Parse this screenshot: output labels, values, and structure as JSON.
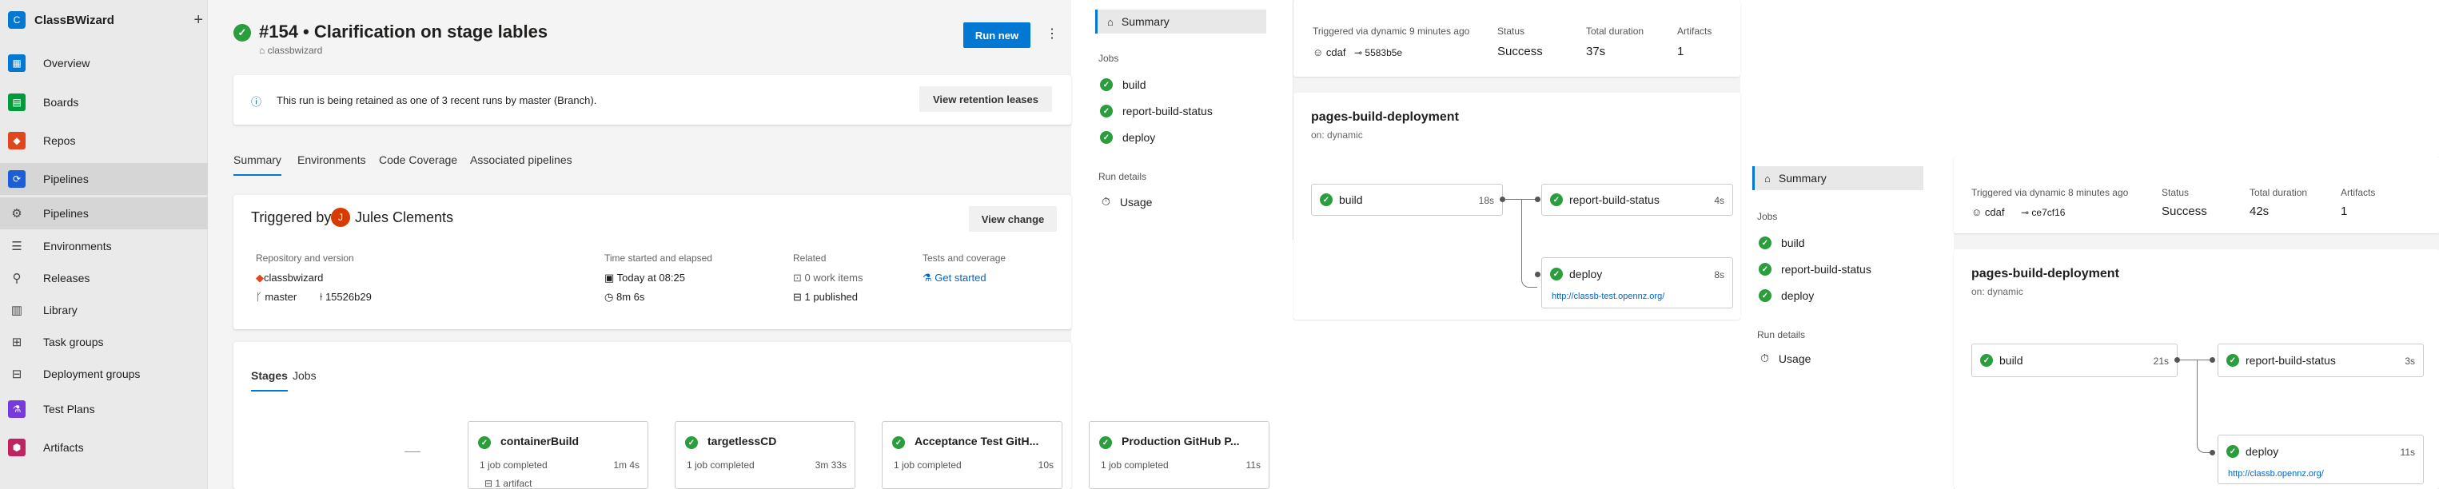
{
  "org": {
    "badge": "C",
    "name": "ClassBWizard",
    "add": "+"
  },
  "nav": {
    "items": [
      {
        "label": "Overview",
        "icon": "overview-icon",
        "color": "#0078d4",
        "glyph": "▦"
      },
      {
        "label": "Boards",
        "icon": "boards-icon",
        "color": "#009c3b",
        "glyph": "▤"
      },
      {
        "label": "Repos",
        "icon": "repos-icon",
        "color": "#e0471c",
        "glyph": "◆"
      },
      {
        "label": "Pipelines",
        "icon": "pipelines-icon",
        "color": "#1c5ed8",
        "glyph": "⟳"
      },
      {
        "label": "Pipelines",
        "icon": "pipelines-sub-icon",
        "color": "#444",
        "glyph": "⚙"
      },
      {
        "label": "Environments",
        "icon": "environments-icon",
        "color": "#444",
        "glyph": "☰"
      },
      {
        "label": "Releases",
        "icon": "releases-icon",
        "color": "#444",
        "glyph": "⚲"
      },
      {
        "label": "Library",
        "icon": "library-icon",
        "color": "#444",
        "glyph": "▥"
      },
      {
        "label": "Task groups",
        "icon": "task-groups-icon",
        "color": "#444",
        "glyph": "⊞"
      },
      {
        "label": "Deployment groups",
        "icon": "deployment-groups-icon",
        "color": "#444",
        "glyph": "⊟"
      },
      {
        "label": "Test Plans",
        "icon": "test-plans-icon",
        "color": "#773adc",
        "glyph": "⚗"
      },
      {
        "label": "Artifacts",
        "icon": "artifacts-icon",
        "color": "#c0245e",
        "glyph": "⬢"
      }
    ]
  },
  "run": {
    "title": "#154 • Clarification on stage lables",
    "repo": "classbwizard",
    "run_new": "Run new",
    "more": "⋮",
    "banner": "This run is being retained as one of 3 recent runs by master (Branch).",
    "view_retention": "View retention leases",
    "tabs": [
      "Summary",
      "Environments",
      "Code Coverage",
      "Associated pipelines"
    ],
    "triggered_by_label": "Triggered by",
    "triggered_by": "Jules Clements",
    "view_change": "View change",
    "repo_version_label": "Repository and version",
    "repo_name": "classbwizard",
    "branch": "master",
    "commit": "15526b29",
    "time_label": "Time started and elapsed",
    "time_started": "Today at 08:25",
    "elapsed": "8m 6s",
    "related_label": "Related",
    "work_items": "0 work items",
    "published": "1 published",
    "tests_label": "Tests and coverage",
    "get_started": "Get started",
    "stage_tabs": [
      "Stages",
      "Jobs"
    ],
    "stages": [
      {
        "name": "containerBuild",
        "jobs": "1 job completed",
        "duration": "1m 4s",
        "extra": "1 artifact"
      },
      {
        "name": "targetlessCD",
        "jobs": "1 job completed",
        "duration": "3m 33s",
        "extra": ""
      },
      {
        "name": "Acceptance Test GitH...",
        "jobs": "1 job completed",
        "duration": "10s",
        "extra": ""
      },
      {
        "name": "Production GitHub P...",
        "jobs": "1 job completed",
        "duration": "11s",
        "extra": ""
      }
    ]
  },
  "panel1": {
    "summary": "Summary",
    "jobs_label": "Jobs",
    "jobs": [
      "build",
      "report-build-status",
      "deploy"
    ],
    "run_details": "Run details",
    "usage": "Usage",
    "triggered": "Triggered via dynamic 9 minutes ago",
    "user": "cdaf",
    "commit": "5583b5e",
    "status_label": "Status",
    "status": "Success",
    "duration_label": "Total duration",
    "duration": "37s",
    "artifacts_label": "Artifacts",
    "artifacts": "1",
    "workflow": "pages-build-deployment",
    "on": "on: dynamic",
    "build_dur": "18s",
    "report_dur": "4s",
    "deploy_dur": "8s",
    "deploy_url": "http://classb-test.opennz.org/"
  },
  "panel2": {
    "summary": "Summary",
    "jobs_label": "Jobs",
    "jobs": [
      "build",
      "report-build-status",
      "deploy"
    ],
    "run_details": "Run details",
    "usage": "Usage",
    "triggered": "Triggered via dynamic 8 minutes ago",
    "user": "cdaf",
    "commit": "ce7cf16",
    "status_label": "Status",
    "status": "Success",
    "duration_label": "Total duration",
    "duration": "42s",
    "artifacts_label": "Artifacts",
    "artifacts": "1",
    "workflow": "pages-build-deployment",
    "on": "on: dynamic",
    "build_dur": "21s",
    "report_dur": "3s",
    "deploy_dur": "11s",
    "deploy_url": "http://classb.opennz.org/"
  }
}
